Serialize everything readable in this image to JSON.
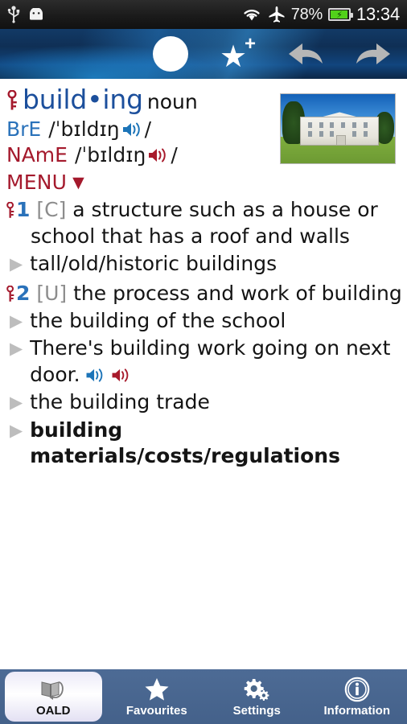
{
  "statusbar": {
    "icons": [
      "usb-icon",
      "android-robot-icon",
      "wifi-icon",
      "airplane-mode-icon"
    ],
    "battery_percent": "78%",
    "battery_state": "charging",
    "clock": "13:34"
  },
  "toolbar": {
    "buttons": [
      {
        "name": "search-button",
        "icon": "white-circle-icon",
        "label": ""
      },
      {
        "name": "add-favourite-button",
        "icon": "star-plus-icon",
        "label": ""
      },
      {
        "name": "back-button",
        "icon": "back-arrow-icon",
        "label": ""
      },
      {
        "name": "forward-button",
        "icon": "forward-arrow-icon",
        "label": ""
      }
    ]
  },
  "entry": {
    "key_icon": "key-icon",
    "headword": "build•ing",
    "part_of_speech": "noun",
    "pronunciations": [
      {
        "label": "BrE",
        "open": "/",
        "ipa": "ˈbɪldɪŋ",
        "close": "/",
        "speaker": "speaker-icon-bre"
      },
      {
        "label": "NAmE",
        "open": "/",
        "ipa": "ˈbɪldɪŋ",
        "close": "/",
        "speaker": "speaker-icon-name"
      }
    ],
    "menu_label": "MENU",
    "menu_caret": "▼",
    "image_alt": "photo of a large white neoclassical building with lawn",
    "senses": [
      {
        "number": "1",
        "grammar": "[C]",
        "definition": "a structure such as a house or school that has a roof and walls",
        "examples": [
          {
            "text": "tall/old/historic buildings",
            "bold": false,
            "speakers": []
          }
        ]
      },
      {
        "number": "2",
        "grammar": "[U]",
        "definition": "the process and work of building",
        "examples": [
          {
            "text": "the building of the school",
            "bold": false,
            "speakers": []
          },
          {
            "text": "There's building work going on next door.",
            "bold": false,
            "speakers": [
              "speaker-icon-bre",
              "speaker-icon-name"
            ]
          },
          {
            "text": "the building trade",
            "bold": false,
            "speakers": []
          },
          {
            "text": "building materials/costs/regulations",
            "bold": true,
            "speakers": []
          }
        ]
      }
    ]
  },
  "bottom_nav": {
    "tabs": [
      {
        "label": "OALD",
        "icon": "book-back-icon",
        "active": true
      },
      {
        "label": "Favourites",
        "icon": "star-icon",
        "active": false
      },
      {
        "label": "Settings",
        "icon": "gears-icon",
        "active": false
      },
      {
        "label": "Information",
        "icon": "info-circle-icon",
        "active": false
      }
    ]
  },
  "colors": {
    "headword_blue": "#1c4f9c",
    "label_bre_blue": "#2a72ba",
    "label_name_red": "#a4192c",
    "menu_red": "#a4192c",
    "grammar_grey": "#8d8d8d",
    "nav_bar_blue": "#4a6789",
    "battery_green": "#52d11a"
  }
}
